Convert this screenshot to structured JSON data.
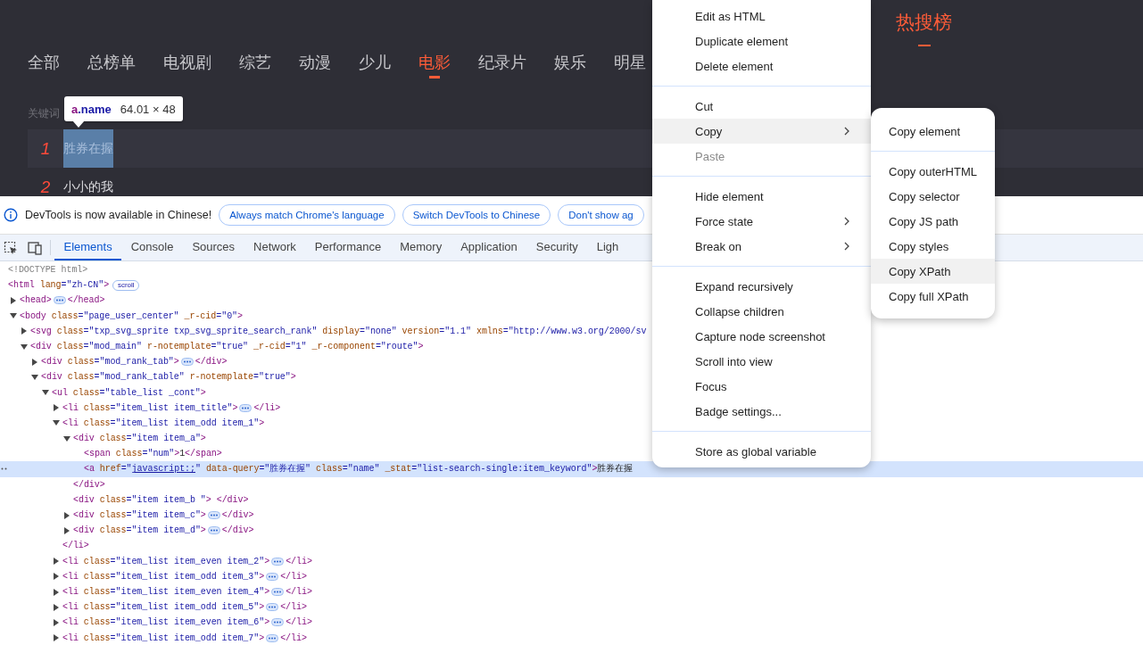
{
  "page": {
    "heading": "热搜榜",
    "tabs": [
      {
        "label": "全部",
        "selected": false
      },
      {
        "label": "总榜单",
        "selected": false
      },
      {
        "label": "电视剧",
        "selected": false
      },
      {
        "label": "综艺",
        "selected": false
      },
      {
        "label": "动漫",
        "selected": false
      },
      {
        "label": "少儿",
        "selected": false
      },
      {
        "label": "电影",
        "selected": true
      },
      {
        "label": "纪录片",
        "selected": false
      },
      {
        "label": "娱乐",
        "selected": false
      },
      {
        "label": "明星",
        "selected": false
      }
    ],
    "keyword_label": "关键词",
    "ranks": [
      {
        "rank": "1",
        "name": "胜券在握",
        "selected": true
      },
      {
        "rank": "2",
        "name": "小小的我",
        "selected": false
      }
    ],
    "tooltip": {
      "tag": "a",
      "class_name": ".name",
      "size": "64.01 × 48"
    }
  },
  "devtools": {
    "infobar": {
      "message": "DevTools is now available in Chinese!",
      "buttons": [
        "Always match Chrome's language",
        "Switch DevTools to Chinese",
        "Don't show ag"
      ]
    },
    "tabs": [
      {
        "label": "Elements",
        "selected": true
      },
      {
        "label": "Console",
        "selected": false
      },
      {
        "label": "Sources",
        "selected": false
      },
      {
        "label": "Network",
        "selected": false
      },
      {
        "label": "Performance",
        "selected": false
      },
      {
        "label": "Memory",
        "selected": false
      },
      {
        "label": "Application",
        "selected": false
      },
      {
        "label": "Security",
        "selected": false
      },
      {
        "label": "Ligh",
        "selected": false
      }
    ],
    "dom_tree": [
      {
        "selected": false,
        "open": [
          {
            "kind": "doctype",
            "text": "<!DOCTYPE html>"
          }
        ]
      },
      {
        "selected": false,
        "open": [
          {
            "kind": "tag",
            "text": "<html"
          },
          {
            "kind": "attr",
            "text": " lang"
          },
          {
            "kind": "value",
            "text": "=\"zh-CN\""
          },
          {
            "kind": "tag",
            "text": ">"
          }
        ],
        "badge": "scroll",
        "children": [
          {
            "selected": false,
            "expanded": false,
            "open": [
              {
                "kind": "tag",
                "text": "<head>"
              }
            ],
            "close": [
              {
                "kind": "tag",
                "text": "</head>"
              }
            ]
          },
          {
            "selected": false,
            "expanded": true,
            "open": [
              {
                "kind": "tag",
                "text": "<body"
              },
              {
                "kind": "attr",
                "text": " class"
              },
              {
                "kind": "value",
                "text": "=\"page_user_center\""
              },
              {
                "kind": "attr",
                "text": " _r-cid"
              },
              {
                "kind": "value",
                "text": "=\"0\""
              },
              {
                "kind": "tag",
                "text": ">"
              }
            ],
            "children": [
              {
                "selected": false,
                "expanded": false,
                "open": [
                  {
                    "kind": "tag",
                    "text": "<svg"
                  },
                  {
                    "kind": "attr",
                    "text": " class"
                  },
                  {
                    "kind": "value",
                    "text": "=\"txp_svg_sprite txp_svg_sprite_search_rank\""
                  },
                  {
                    "kind": "attr",
                    "text": " display"
                  },
                  {
                    "kind": "value",
                    "text": "=\"none\""
                  },
                  {
                    "kind": "attr",
                    "text": " version"
                  },
                  {
                    "kind": "value",
                    "text": "=\"1.1\""
                  },
                  {
                    "kind": "attr",
                    "text": " xmlns"
                  },
                  {
                    "kind": "value",
                    "text": "=\"http://www.w3.org/2000/sv"
                  }
                ]
              },
              {
                "selected": false,
                "expanded": true,
                "open": [
                  {
                    "kind": "tag",
                    "text": "<div"
                  },
                  {
                    "kind": "attr",
                    "text": " class"
                  },
                  {
                    "kind": "value",
                    "text": "=\"mod_main\""
                  },
                  {
                    "kind": "attr",
                    "text": " r-notemplate"
                  },
                  {
                    "kind": "value",
                    "text": "=\"true\""
                  },
                  {
                    "kind": "attr",
                    "text": " _r-cid"
                  },
                  {
                    "kind": "value",
                    "text": "=\"1\""
                  },
                  {
                    "kind": "attr",
                    "text": " _r-component"
                  },
                  {
                    "kind": "value",
                    "text": "=\"route\""
                  },
                  {
                    "kind": "tag",
                    "text": ">"
                  }
                ],
                "children": [
                  {
                    "selected": false,
                    "expanded": false,
                    "open": [
                      {
                        "kind": "tag",
                        "text": "<div"
                      },
                      {
                        "kind": "attr",
                        "text": " class"
                      },
                      {
                        "kind": "value",
                        "text": "=\"mod_rank_tab\""
                      },
                      {
                        "kind": "tag",
                        "text": ">"
                      }
                    ],
                    "close": [
                      {
                        "kind": "tag",
                        "text": "</div>"
                      }
                    ]
                  },
                  {
                    "selected": false,
                    "expanded": true,
                    "open": [
                      {
                        "kind": "tag",
                        "text": "<div"
                      },
                      {
                        "kind": "attr",
                        "text": " class"
                      },
                      {
                        "kind": "value",
                        "text": "=\"mod_rank_table\""
                      },
                      {
                        "kind": "attr",
                        "text": " r-notemplate"
                      },
                      {
                        "kind": "value",
                        "text": "=\"true\""
                      },
                      {
                        "kind": "tag",
                        "text": ">"
                      }
                    ],
                    "children": [
                      {
                        "selected": false,
                        "expanded": true,
                        "open": [
                          {
                            "kind": "tag",
                            "text": "<ul"
                          },
                          {
                            "kind": "attr",
                            "text": " class"
                          },
                          {
                            "kind": "value",
                            "text": "=\"table_list _cont\""
                          },
                          {
                            "kind": "tag",
                            "text": ">"
                          }
                        ],
                        "children": [
                          {
                            "selected": false,
                            "expanded": false,
                            "open": [
                              {
                                "kind": "tag",
                                "text": "<li"
                              },
                              {
                                "kind": "attr",
                                "text": " class"
                              },
                              {
                                "kind": "value",
                                "text": "=\"item_list item_title\""
                              },
                              {
                                "kind": "tag",
                                "text": ">"
                              }
                            ],
                            "close": [
                              {
                                "kind": "tag",
                                "text": "</li>"
                              }
                            ]
                          },
                          {
                            "selected": false,
                            "expanded": true,
                            "open": [
                              {
                                "kind": "tag",
                                "text": "<li"
                              },
                              {
                                "kind": "attr",
                                "text": " class"
                              },
                              {
                                "kind": "value",
                                "text": "=\"item_list item_odd item_1\""
                              },
                              {
                                "kind": "tag",
                                "text": ">"
                              }
                            ],
                            "close": [
                              {
                                "kind": "tag",
                                "text": "</li>"
                              }
                            ],
                            "children": [
                              {
                                "selected": false,
                                "expanded": true,
                                "open": [
                                  {
                                    "kind": "tag",
                                    "text": "<div"
                                  },
                                  {
                                    "kind": "attr",
                                    "text": " class"
                                  },
                                  {
                                    "kind": "value",
                                    "text": "=\"item item_a\""
                                  },
                                  {
                                    "kind": "tag",
                                    "text": ">"
                                  }
                                ],
                                "close": [
                                  {
                                    "kind": "tag",
                                    "text": "</div>"
                                  }
                                ],
                                "children": [
                                  {
                                    "selected": false,
                                    "open": [
                                      {
                                        "kind": "tag",
                                        "text": "<span"
                                      },
                                      {
                                        "kind": "attr",
                                        "text": " class"
                                      },
                                      {
                                        "kind": "value",
                                        "text": "=\"num\""
                                      },
                                      {
                                        "kind": "tag",
                                        "text": ">"
                                      },
                                      {
                                        "kind": "text",
                                        "text": "1"
                                      },
                                      {
                                        "kind": "tag",
                                        "text": "</span>"
                                      }
                                    ]
                                  },
                                  {
                                    "selected": true,
                                    "open": [
                                      {
                                        "kind": "tag",
                                        "text": "<a"
                                      },
                                      {
                                        "kind": "attr",
                                        "text": " href"
                                      },
                                      {
                                        "kind": "value",
                                        "text": "=\""
                                      },
                                      {
                                        "kind": "link",
                                        "text": "javascript:;"
                                      },
                                      {
                                        "kind": "value",
                                        "text": "\""
                                      },
                                      {
                                        "kind": "attr",
                                        "text": " data-query"
                                      },
                                      {
                                        "kind": "value",
                                        "text": "=\"胜券在握\""
                                      },
                                      {
                                        "kind": "attr",
                                        "text": " class"
                                      },
                                      {
                                        "kind": "value",
                                        "text": "=\"name\""
                                      },
                                      {
                                        "kind": "attr",
                                        "text": " _stat"
                                      },
                                      {
                                        "kind": "value",
                                        "text": "=\"list-search-single:item_keyword\""
                                      },
                                      {
                                        "kind": "tag",
                                        "text": ">"
                                      },
                                      {
                                        "kind": "text",
                                        "text": "胜券在握"
                                      }
                                    ]
                                  }
                                ]
                              },
                              {
                                "selected": false,
                                "open": [
                                  {
                                    "kind": "tag",
                                    "text": "<div"
                                  },
                                  {
                                    "kind": "attr",
                                    "text": " class"
                                  },
                                  {
                                    "kind": "value",
                                    "text": "=\"item item_b \""
                                  },
                                  {
                                    "kind": "tag",
                                    "text": "> </div>"
                                  }
                                ]
                              },
                              {
                                "selected": false,
                                "expanded": false,
                                "open": [
                                  {
                                    "kind": "tag",
                                    "text": "<div"
                                  },
                                  {
                                    "kind": "attr",
                                    "text": " class"
                                  },
                                  {
                                    "kind": "value",
                                    "text": "=\"item item_c\""
                                  },
                                  {
                                    "kind": "tag",
                                    "text": ">"
                                  }
                                ],
                                "close": [
                                  {
                                    "kind": "tag",
                                    "text": "</div>"
                                  }
                                ]
                              },
                              {
                                "selected": false,
                                "expanded": false,
                                "open": [
                                  {
                                    "kind": "tag",
                                    "text": "<div"
                                  },
                                  {
                                    "kind": "attr",
                                    "text": " class"
                                  },
                                  {
                                    "kind": "value",
                                    "text": "=\"item item_d\""
                                  },
                                  {
                                    "kind": "tag",
                                    "text": ">"
                                  }
                                ],
                                "close": [
                                  {
                                    "kind": "tag",
                                    "text": "</div>"
                                  }
                                ]
                              }
                            ]
                          },
                          {
                            "selected": false,
                            "expanded": false,
                            "open": [
                              {
                                "kind": "tag",
                                "text": "<li"
                              },
                              {
                                "kind": "attr",
                                "text": " class"
                              },
                              {
                                "kind": "value",
                                "text": "=\"item_list item_even item_2\""
                              },
                              {
                                "kind": "tag",
                                "text": ">"
                              }
                            ],
                            "close": [
                              {
                                "kind": "tag",
                                "text": "</li>"
                              }
                            ]
                          },
                          {
                            "selected": false,
                            "expanded": false,
                            "open": [
                              {
                                "kind": "tag",
                                "text": "<li"
                              },
                              {
                                "kind": "attr",
                                "text": " class"
                              },
                              {
                                "kind": "value",
                                "text": "=\"item_list item_odd item_3\""
                              },
                              {
                                "kind": "tag",
                                "text": ">"
                              }
                            ],
                            "close": [
                              {
                                "kind": "tag",
                                "text": "</li>"
                              }
                            ]
                          },
                          {
                            "selected": false,
                            "expanded": false,
                            "open": [
                              {
                                "kind": "tag",
                                "text": "<li"
                              },
                              {
                                "kind": "attr",
                                "text": " class"
                              },
                              {
                                "kind": "value",
                                "text": "=\"item_list item_even item_4\""
                              },
                              {
                                "kind": "tag",
                                "text": ">"
                              }
                            ],
                            "close": [
                              {
                                "kind": "tag",
                                "text": "</li>"
                              }
                            ]
                          },
                          {
                            "selected": false,
                            "expanded": false,
                            "open": [
                              {
                                "kind": "tag",
                                "text": "<li"
                              },
                              {
                                "kind": "attr",
                                "text": " class"
                              },
                              {
                                "kind": "value",
                                "text": "=\"item_list item_odd item_5\""
                              },
                              {
                                "kind": "tag",
                                "text": ">"
                              }
                            ],
                            "close": [
                              {
                                "kind": "tag",
                                "text": "</li>"
                              }
                            ]
                          },
                          {
                            "selected": false,
                            "expanded": false,
                            "open": [
                              {
                                "kind": "tag",
                                "text": "<li"
                              },
                              {
                                "kind": "attr",
                                "text": " class"
                              },
                              {
                                "kind": "value",
                                "text": "=\"item_list item_even item_6\""
                              },
                              {
                                "kind": "tag",
                                "text": ">"
                              }
                            ],
                            "close": [
                              {
                                "kind": "tag",
                                "text": "</li>"
                              }
                            ]
                          },
                          {
                            "selected": false,
                            "expanded": false,
                            "open": [
                              {
                                "kind": "tag",
                                "text": "<li"
                              },
                              {
                                "kind": "attr",
                                "text": " class"
                              },
                              {
                                "kind": "value",
                                "text": "=\"item_list item_odd item_7\""
                              },
                              {
                                "kind": "tag",
                                "text": ">"
                              }
                            ],
                            "close": [
                              {
                                "kind": "tag",
                                "text": "</li>"
                              }
                            ]
                          }
                        ]
                      }
                    ]
                  }
                ]
              }
            ]
          }
        ]
      }
    ]
  },
  "context_menu": {
    "groups": [
      {
        "items": [
          {
            "label": "Edit as HTML",
            "selected": false,
            "disabled": false,
            "submenu": false
          },
          {
            "label": "Duplicate element",
            "selected": false,
            "disabled": false,
            "submenu": false
          },
          {
            "label": "Delete element",
            "selected": false,
            "disabled": false,
            "submenu": false
          }
        ]
      },
      {
        "items": [
          {
            "label": "Cut",
            "selected": false,
            "disabled": false,
            "submenu": false
          },
          {
            "label": "Copy",
            "selected": true,
            "disabled": false,
            "submenu": true
          },
          {
            "label": "Paste",
            "selected": false,
            "disabled": true,
            "submenu": false
          }
        ]
      },
      {
        "items": [
          {
            "label": "Hide element",
            "selected": false,
            "disabled": false,
            "submenu": false
          },
          {
            "label": "Force state",
            "selected": false,
            "disabled": false,
            "submenu": true
          },
          {
            "label": "Break on",
            "selected": false,
            "disabled": false,
            "submenu": true
          }
        ]
      },
      {
        "items": [
          {
            "label": "Expand recursively",
            "selected": false,
            "disabled": false,
            "submenu": false
          },
          {
            "label": "Collapse children",
            "selected": false,
            "disabled": false,
            "submenu": false
          },
          {
            "label": "Capture node screenshot",
            "selected": false,
            "disabled": false,
            "submenu": false
          },
          {
            "label": "Scroll into view",
            "selected": false,
            "disabled": false,
            "submenu": false
          },
          {
            "label": "Focus",
            "selected": false,
            "disabled": false,
            "submenu": false
          },
          {
            "label": "Badge settings...",
            "selected": false,
            "disabled": false,
            "submenu": false
          }
        ]
      },
      {
        "items": [
          {
            "label": "Store as global variable",
            "selected": false,
            "disabled": false,
            "submenu": false
          }
        ]
      }
    ]
  },
  "submenu": {
    "groups": [
      {
        "items": [
          {
            "label": "Copy element",
            "selected": false,
            "disabled": false,
            "submenu": false
          }
        ]
      },
      {
        "items": [
          {
            "label": "Copy outerHTML",
            "selected": false,
            "disabled": false,
            "submenu": false
          },
          {
            "label": "Copy selector",
            "selected": false,
            "disabled": false,
            "submenu": false
          },
          {
            "label": "Copy JS path",
            "selected": false,
            "disabled": false,
            "submenu": false
          },
          {
            "label": "Copy styles",
            "selected": false,
            "disabled": false,
            "submenu": false
          },
          {
            "label": "Copy XPath",
            "selected": true,
            "disabled": false,
            "submenu": false
          },
          {
            "label": "Copy full XPath",
            "selected": false,
            "disabled": false,
            "submenu": false
          }
        ]
      }
    ]
  }
}
